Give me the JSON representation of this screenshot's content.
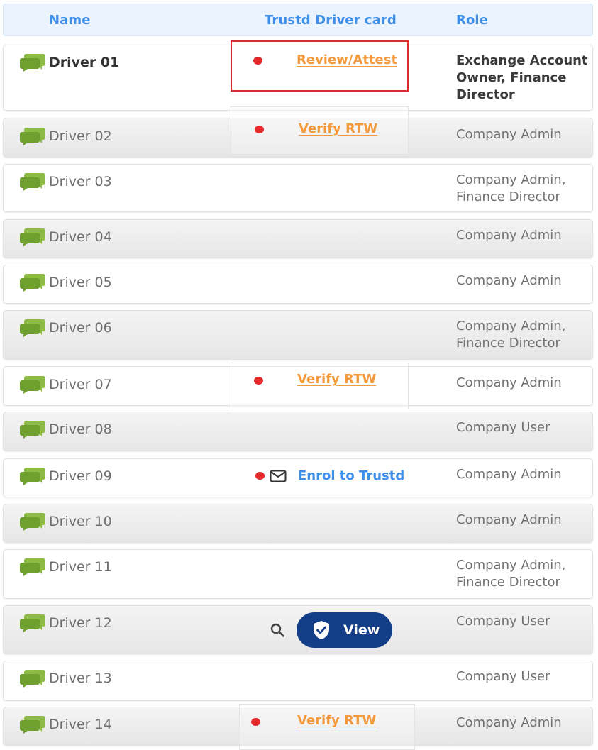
{
  "header": {
    "name": "Name",
    "card": "Trustd Driver card",
    "role": "Role"
  },
  "rows": [
    {
      "name": "Driver 01",
      "role": "Exchange Account Owner, Finance Director",
      "action": "Review/Attest"
    },
    {
      "name": "Driver 02",
      "role": "Company Admin",
      "action": "Verify RTW"
    },
    {
      "name": "Driver 03",
      "role": "Company Admin, Finance Director"
    },
    {
      "name": "Driver 04",
      "role": "Company Admin"
    },
    {
      "name": "Driver 05",
      "role": "Company Admin"
    },
    {
      "name": "Driver 06",
      "role": "Company Admin, Finance Director"
    },
    {
      "name": "Driver 07",
      "role": "Company Admin",
      "action": "Verify RTW"
    },
    {
      "name": "Driver 08",
      "role": "Company User"
    },
    {
      "name": "Driver 09",
      "role": "Company Admin",
      "action": "Enrol to Trustd"
    },
    {
      "name": "Driver 10",
      "role": "Company Admin"
    },
    {
      "name": "Driver 11",
      "role": "Company Admin, Finance Director"
    },
    {
      "name": "Driver 12",
      "role": "Company User",
      "action": "View"
    },
    {
      "name": "Driver 13",
      "role": "Company User"
    },
    {
      "name": "Driver 14",
      "role": "Company Admin",
      "action": "Verify RTW"
    }
  ],
  "icons": {
    "row_icon": "chat-bubbles-icon",
    "status_icon": "red-dot-icon",
    "mail_icon": "mail-icon",
    "search_icon": "search-icon",
    "view_icon": "shield-check-icon"
  },
  "colors": {
    "header_text": "#3e8fe8",
    "link_orange": "#f59a3c",
    "status_red": "#e5282a",
    "view_button": "#133d86",
    "icon_green": "#7cab3a"
  }
}
